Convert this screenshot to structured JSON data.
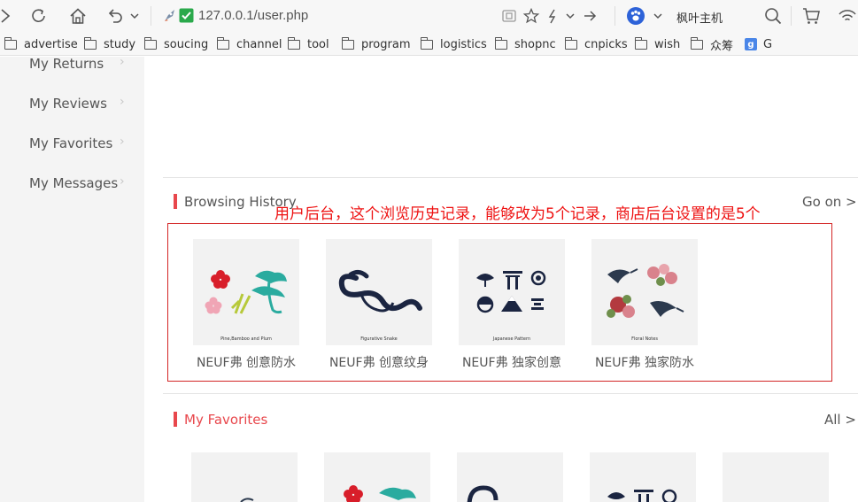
{
  "browser": {
    "url": "127.0.0.1/user.php",
    "search_engine_text": "枫叶主机",
    "bookmarks": [
      {
        "label": "advertise"
      },
      {
        "label": "study"
      },
      {
        "label": "soucing"
      },
      {
        "label": "channel"
      },
      {
        "label": "tool"
      },
      {
        "label": "program"
      },
      {
        "label": "logistics"
      },
      {
        "label": "shopnc"
      },
      {
        "label": "cnpicks"
      },
      {
        "label": "wish"
      },
      {
        "label": "众筹"
      },
      {
        "label": "G"
      }
    ]
  },
  "sidebar": {
    "items": [
      {
        "label": "My Returns"
      },
      {
        "label": "My Reviews"
      },
      {
        "label": "My Favorites"
      },
      {
        "label": "My Messages"
      }
    ]
  },
  "history": {
    "title": "Browsing History",
    "more_label": "Go on >",
    "annotation": "用户后台，这个浏览历史记录，能够改为5个记录，商店后台设置的是5个",
    "products": [
      {
        "name": "NEUF弗 创意防水",
        "caption": "Pine,Bamboo and Plum"
      },
      {
        "name": "NEUF弗 创意纹身",
        "caption": "Figurative Snake"
      },
      {
        "name": "NEUF弗 独家创意",
        "caption": "Japanese Pattern"
      },
      {
        "name": "NEUF弗 独家防水",
        "caption": "Floral Notes"
      }
    ]
  },
  "favorites": {
    "title": "My Favorites",
    "more_label": "All >"
  },
  "colors": {
    "accent": "#e8474c",
    "annotation": "#ee1111",
    "sidebar_bg": "#f4f4f4"
  }
}
